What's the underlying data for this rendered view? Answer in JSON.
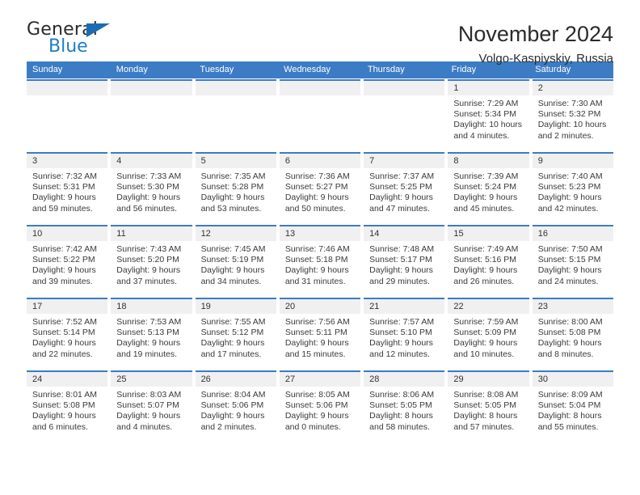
{
  "logo": {
    "word_one": "General",
    "word_two": "Blue",
    "triangle_color": "#1b6cb5",
    "blue_color": "#1f7ec4"
  },
  "header": {
    "title": "November 2024",
    "location": "Volgo-Kaspiyskiy, Russia"
  },
  "calendar": {
    "accent_color": "#3b7cc4",
    "daynum_bg": "#f0f0f0",
    "weekdays": [
      "Sunday",
      "Monday",
      "Tuesday",
      "Wednesday",
      "Thursday",
      "Friday",
      "Saturday"
    ],
    "weeks": [
      [
        {
          "day": "",
          "lines": []
        },
        {
          "day": "",
          "lines": []
        },
        {
          "day": "",
          "lines": []
        },
        {
          "day": "",
          "lines": []
        },
        {
          "day": "",
          "lines": []
        },
        {
          "day": "1",
          "lines": [
            "Sunrise: 7:29 AM",
            "Sunset: 5:34 PM",
            "Daylight: 10 hours",
            "and 4 minutes."
          ]
        },
        {
          "day": "2",
          "lines": [
            "Sunrise: 7:30 AM",
            "Sunset: 5:32 PM",
            "Daylight: 10 hours",
            "and 2 minutes."
          ]
        }
      ],
      [
        {
          "day": "3",
          "lines": [
            "Sunrise: 7:32 AM",
            "Sunset: 5:31 PM",
            "Daylight: 9 hours",
            "and 59 minutes."
          ]
        },
        {
          "day": "4",
          "lines": [
            "Sunrise: 7:33 AM",
            "Sunset: 5:30 PM",
            "Daylight: 9 hours",
            "and 56 minutes."
          ]
        },
        {
          "day": "5",
          "lines": [
            "Sunrise: 7:35 AM",
            "Sunset: 5:28 PM",
            "Daylight: 9 hours",
            "and 53 minutes."
          ]
        },
        {
          "day": "6",
          "lines": [
            "Sunrise: 7:36 AM",
            "Sunset: 5:27 PM",
            "Daylight: 9 hours",
            "and 50 minutes."
          ]
        },
        {
          "day": "7",
          "lines": [
            "Sunrise: 7:37 AM",
            "Sunset: 5:25 PM",
            "Daylight: 9 hours",
            "and 47 minutes."
          ]
        },
        {
          "day": "8",
          "lines": [
            "Sunrise: 7:39 AM",
            "Sunset: 5:24 PM",
            "Daylight: 9 hours",
            "and 45 minutes."
          ]
        },
        {
          "day": "9",
          "lines": [
            "Sunrise: 7:40 AM",
            "Sunset: 5:23 PM",
            "Daylight: 9 hours",
            "and 42 minutes."
          ]
        }
      ],
      [
        {
          "day": "10",
          "lines": [
            "Sunrise: 7:42 AM",
            "Sunset: 5:22 PM",
            "Daylight: 9 hours",
            "and 39 minutes."
          ]
        },
        {
          "day": "11",
          "lines": [
            "Sunrise: 7:43 AM",
            "Sunset: 5:20 PM",
            "Daylight: 9 hours",
            "and 37 minutes."
          ]
        },
        {
          "day": "12",
          "lines": [
            "Sunrise: 7:45 AM",
            "Sunset: 5:19 PM",
            "Daylight: 9 hours",
            "and 34 minutes."
          ]
        },
        {
          "day": "13",
          "lines": [
            "Sunrise: 7:46 AM",
            "Sunset: 5:18 PM",
            "Daylight: 9 hours",
            "and 31 minutes."
          ]
        },
        {
          "day": "14",
          "lines": [
            "Sunrise: 7:48 AM",
            "Sunset: 5:17 PM",
            "Daylight: 9 hours",
            "and 29 minutes."
          ]
        },
        {
          "day": "15",
          "lines": [
            "Sunrise: 7:49 AM",
            "Sunset: 5:16 PM",
            "Daylight: 9 hours",
            "and 26 minutes."
          ]
        },
        {
          "day": "16",
          "lines": [
            "Sunrise: 7:50 AM",
            "Sunset: 5:15 PM",
            "Daylight: 9 hours",
            "and 24 minutes."
          ]
        }
      ],
      [
        {
          "day": "17",
          "lines": [
            "Sunrise: 7:52 AM",
            "Sunset: 5:14 PM",
            "Daylight: 9 hours",
            "and 22 minutes."
          ]
        },
        {
          "day": "18",
          "lines": [
            "Sunrise: 7:53 AM",
            "Sunset: 5:13 PM",
            "Daylight: 9 hours",
            "and 19 minutes."
          ]
        },
        {
          "day": "19",
          "lines": [
            "Sunrise: 7:55 AM",
            "Sunset: 5:12 PM",
            "Daylight: 9 hours",
            "and 17 minutes."
          ]
        },
        {
          "day": "20",
          "lines": [
            "Sunrise: 7:56 AM",
            "Sunset: 5:11 PM",
            "Daylight: 9 hours",
            "and 15 minutes."
          ]
        },
        {
          "day": "21",
          "lines": [
            "Sunrise: 7:57 AM",
            "Sunset: 5:10 PM",
            "Daylight: 9 hours",
            "and 12 minutes."
          ]
        },
        {
          "day": "22",
          "lines": [
            "Sunrise: 7:59 AM",
            "Sunset: 5:09 PM",
            "Daylight: 9 hours",
            "and 10 minutes."
          ]
        },
        {
          "day": "23",
          "lines": [
            "Sunrise: 8:00 AM",
            "Sunset: 5:08 PM",
            "Daylight: 9 hours",
            "and 8 minutes."
          ]
        }
      ],
      [
        {
          "day": "24",
          "lines": [
            "Sunrise: 8:01 AM",
            "Sunset: 5:08 PM",
            "Daylight: 9 hours",
            "and 6 minutes."
          ]
        },
        {
          "day": "25",
          "lines": [
            "Sunrise: 8:03 AM",
            "Sunset: 5:07 PM",
            "Daylight: 9 hours",
            "and 4 minutes."
          ]
        },
        {
          "day": "26",
          "lines": [
            "Sunrise: 8:04 AM",
            "Sunset: 5:06 PM",
            "Daylight: 9 hours",
            "and 2 minutes."
          ]
        },
        {
          "day": "27",
          "lines": [
            "Sunrise: 8:05 AM",
            "Sunset: 5:06 PM",
            "Daylight: 9 hours",
            "and 0 minutes."
          ]
        },
        {
          "day": "28",
          "lines": [
            "Sunrise: 8:06 AM",
            "Sunset: 5:05 PM",
            "Daylight: 8 hours",
            "and 58 minutes."
          ]
        },
        {
          "day": "29",
          "lines": [
            "Sunrise: 8:08 AM",
            "Sunset: 5:05 PM",
            "Daylight: 8 hours",
            "and 57 minutes."
          ]
        },
        {
          "day": "30",
          "lines": [
            "Sunrise: 8:09 AM",
            "Sunset: 5:04 PM",
            "Daylight: 8 hours",
            "and 55 minutes."
          ]
        }
      ]
    ]
  }
}
